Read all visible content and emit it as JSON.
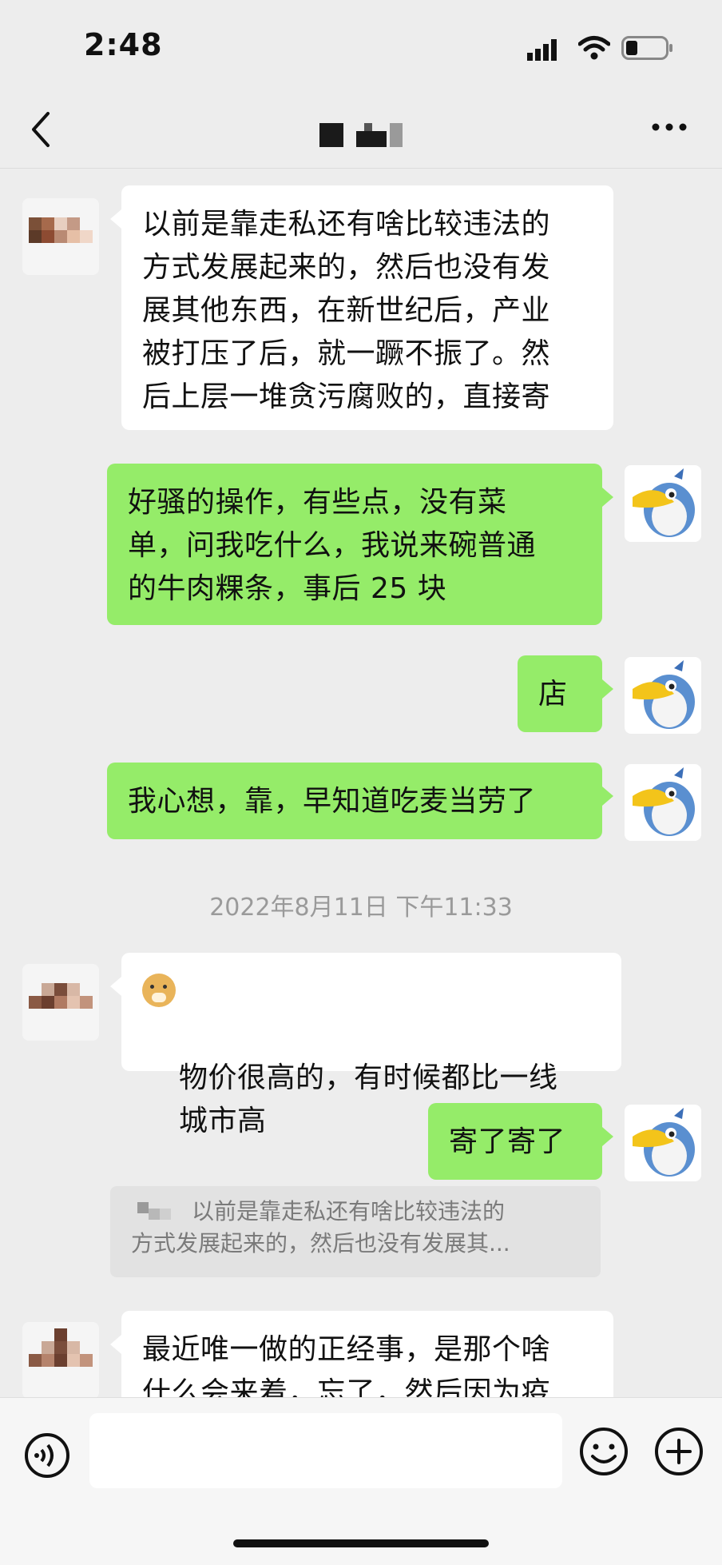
{
  "status_bar": {
    "time": "2:48"
  },
  "chat": {
    "title_placeholder": ""
  },
  "messages": [
    {
      "sender": "other",
      "text": "以前是靠走私还有啥比较违法的\n方式发展起来的，然后也没有发\n展其他东西，在新世纪后，产业\n被打压了后，就一蹶不振了。然\n后上层一堆贪污腐败的，直接寄"
    },
    {
      "sender": "me",
      "text": "好骚的操作，有些点，没有菜\n单，问我吃什么，我说来碗普通\n的牛肉粿条，事后 25 块"
    },
    {
      "sender": "me",
      "text": "店"
    },
    {
      "sender": "me",
      "text": "我心想，靠，早知道吃麦当劳了"
    },
    {
      "sender": "other",
      "text": "物价很高的，有时候都比一线\n城市高"
    },
    {
      "sender": "me",
      "text": "寄了寄了"
    },
    {
      "sender": "other",
      "text": "最近唯一做的正经事，是那个啥\n什么会来着，忘了，然后因为疫"
    }
  ],
  "timestamp": "2022年8月11日 下午11:33",
  "quote": {
    "line1": "以前是靠走私还有啥比较违法的",
    "line2": "方式发展起来的，然后也没有发展其..."
  },
  "input": {
    "placeholder": ""
  },
  "colors": {
    "bubble_out": "#95ec69",
    "bubble_in": "#ffffff",
    "background": "#ededed"
  }
}
